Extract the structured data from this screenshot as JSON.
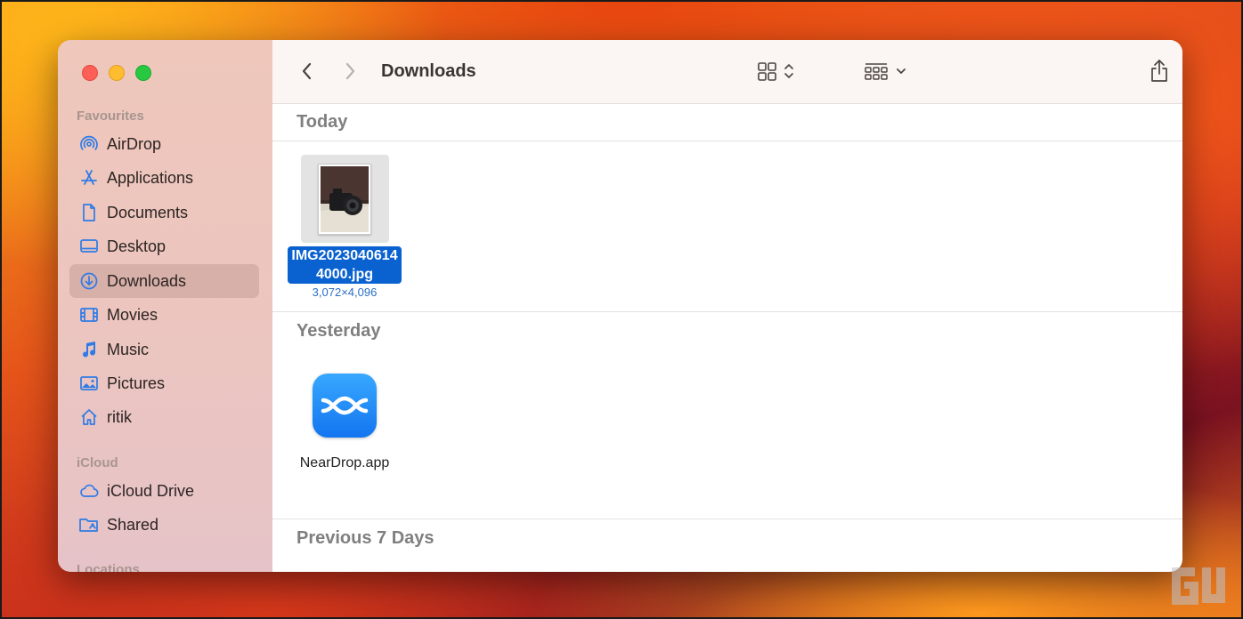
{
  "window": {
    "title": "Downloads"
  },
  "sidebar": {
    "sections": [
      {
        "title": "Favourites",
        "items": [
          {
            "label": "AirDrop",
            "icon": "airdrop-icon"
          },
          {
            "label": "Applications",
            "icon": "applications-icon"
          },
          {
            "label": "Documents",
            "icon": "document-icon"
          },
          {
            "label": "Desktop",
            "icon": "desktop-icon"
          },
          {
            "label": "Downloads",
            "icon": "download-icon",
            "selected": true
          },
          {
            "label": "Movies",
            "icon": "film-icon"
          },
          {
            "label": "Music",
            "icon": "music-note-icon"
          },
          {
            "label": "Pictures",
            "icon": "photo-icon"
          },
          {
            "label": "ritik",
            "icon": "home-icon"
          }
        ]
      },
      {
        "title": "iCloud",
        "items": [
          {
            "label": "iCloud Drive",
            "icon": "cloud-icon"
          },
          {
            "label": "Shared",
            "icon": "shared-folder-icon"
          }
        ]
      },
      {
        "title": "Locations",
        "items": []
      }
    ]
  },
  "toolbar": {
    "back_icon": "chevron-left-icon",
    "forward_icon": "chevron-right-icon",
    "view_icon": "grid-view-icon",
    "group_icon": "group-by-icon",
    "share_icon": "share-icon",
    "tag_icon": "tag-icon",
    "more_icon": "ellipsis-circle-icon",
    "search_icon": "search-icon"
  },
  "groups": [
    {
      "header": "Today",
      "files": [
        {
          "name_line1": "IMG2023040614",
          "name_line2": "4000.jpg",
          "meta": "3,072×4,096",
          "selected": true
        }
      ]
    },
    {
      "header": "Yesterday",
      "files": [
        {
          "name": "NearDrop.app",
          "selected": false
        }
      ]
    },
    {
      "header": "Previous 7 Days",
      "files": []
    }
  ],
  "colors": {
    "selection_blue": "#0a62d0",
    "app_icon_blue": "#1a80f5",
    "close": "#fe5f57",
    "minimize": "#febc2e",
    "zoom": "#28c840"
  }
}
